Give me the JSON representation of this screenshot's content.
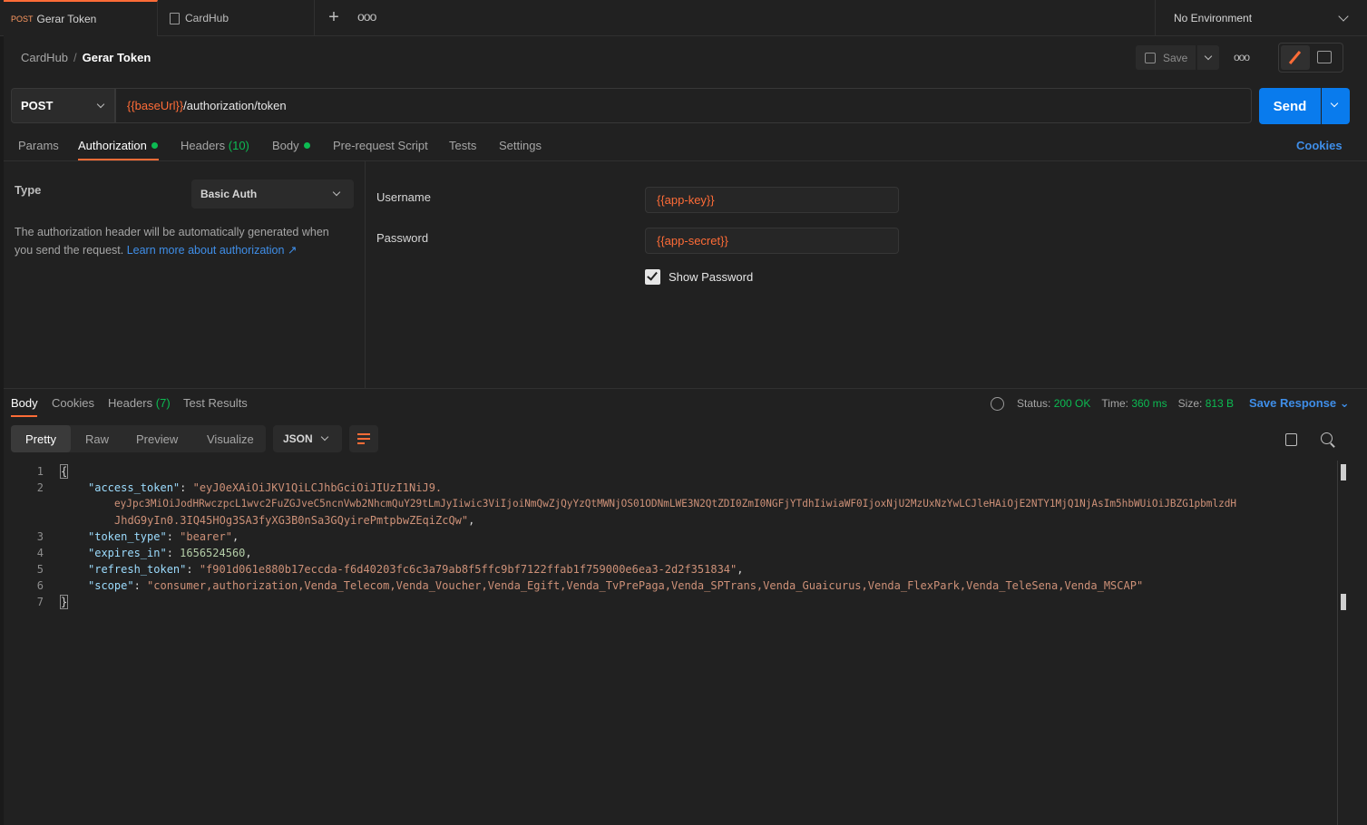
{
  "tabs": {
    "active_method": "POST",
    "active_title": "Gerar Token",
    "second_title": "CardHub",
    "plus": "+",
    "more": "ooo"
  },
  "environment": {
    "label": "No Environment"
  },
  "breadcrumb": {
    "collection": "CardHub",
    "separator": "/",
    "request": "Gerar Token"
  },
  "toolbar": {
    "save_label": "Save",
    "more": "ooo"
  },
  "request": {
    "method": "POST",
    "url_variable": "{{baseUrl}}",
    "url_path": "/authorization/token",
    "send_label": "Send"
  },
  "request_tabs": {
    "params": "Params",
    "authorization": "Authorization",
    "headers": "Headers",
    "headers_count": "(10)",
    "body": "Body",
    "pre_request": "Pre-request Script",
    "tests": "Tests",
    "settings": "Settings",
    "cookies": "Cookies"
  },
  "auth": {
    "type_label": "Type",
    "type_value": "Basic Auth",
    "help_text": "The authorization header will be automatically generated when you send the request. ",
    "help_link": "Learn more about authorization ↗",
    "username_label": "Username",
    "username_value": "{{app-key}}",
    "password_label": "Password",
    "password_value": "{{app-secret}}",
    "show_password_label": "Show Password",
    "show_password_checked": true
  },
  "response_tabs": {
    "body": "Body",
    "cookies": "Cookies",
    "headers": "Headers",
    "headers_count": "(7)",
    "test_results": "Test Results"
  },
  "response_meta": {
    "status_label": "Status:",
    "status_value": "200 OK",
    "time_label": "Time:",
    "time_value": "360 ms",
    "size_label": "Size:",
    "size_value": "813 B",
    "save_response": "Save Response"
  },
  "view_modes": {
    "pretty": "Pretty",
    "raw": "Raw",
    "preview": "Preview",
    "visualize": "Visualize",
    "format": "JSON"
  },
  "response_body": {
    "line_numbers": [
      "1",
      "2",
      "3",
      "4",
      "5",
      "6",
      "7"
    ],
    "open_brace": "{",
    "close_brace": "}",
    "access_token_key": "\"access_token\"",
    "access_token_line1": "\"eyJ0eXAiOiJKV1QiLCJhbGciOiJIUzI1NiJ9.",
    "access_token_line2": "eyJpc3MiOiJodHRwczpcL1wvc2FuZGJveC5ncnVwb2NhcmQuY29tLmJyIiwic3ViIjoiNmQwZjQyYzQtMWNjOS01ODNmLWE3N2QtZDI0ZmI0NGFjYTdhIiwiaWF0IjoxNjU2MzUxNzYwLCJleHAiOjE2NTY1MjQ1NjAsIm5hbWUiOiJBZG1pbmlzdH",
    "access_token_line3": "JhdG9yIn0.3IQ45HOg3SA3fyXG3B0nSa3GQyirePmtpbwZEqiZcQw\"",
    "token_type_key": "\"token_type\"",
    "token_type_value": "\"bearer\"",
    "expires_in_key": "\"expires_in\"",
    "expires_in_value": "1656524560",
    "refresh_token_key": "\"refresh_token\"",
    "refresh_token_value": "\"f901d061e880b17eccda-f6d40203fc6c3a79ab8f5ffc9bf7122ffab1f759000e6ea3-2d2f351834\"",
    "scope_key": "\"scope\"",
    "scope_value": "\"consumer,authorization,Venda_Telecom,Venda_Voucher,Venda_Egift,Venda_TvPrePaga,Venda_SPTrans,Venda_Guaicurus,Venda_FlexPark,Venda_TeleSena,Venda_MSCAP\""
  },
  "colors": {
    "accent": "#ff6c37",
    "primary": "#097bed",
    "success": "#0cbb52",
    "link": "#3f8ee8"
  }
}
